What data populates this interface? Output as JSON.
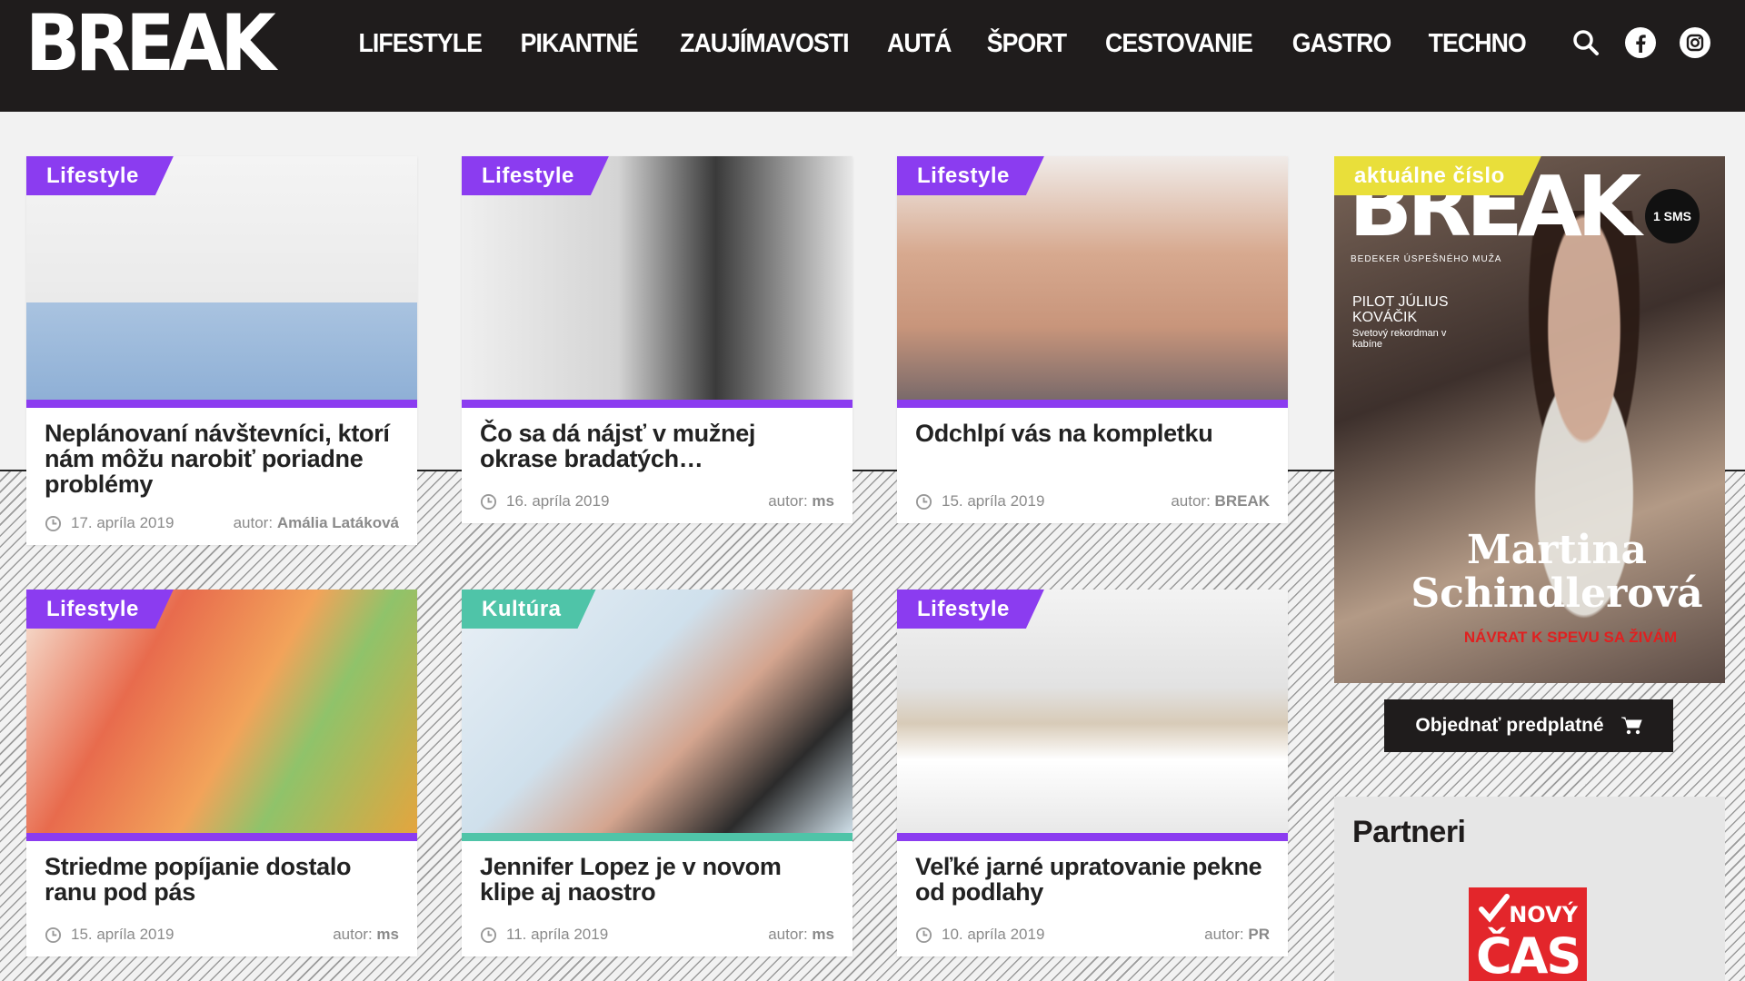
{
  "brand": {
    "logo_text": "BREAK"
  },
  "nav": {
    "items": [
      "LIFESTYLE",
      "PIKANTNÉ",
      "ZAUJÍMAVOSTI",
      "AUTÁ",
      "ŠPORT",
      "CESTOVANIE",
      "GASTRO",
      "TECHNO"
    ]
  },
  "header_icons": [
    "search-icon",
    "facebook-icon",
    "instagram-icon"
  ],
  "colors": {
    "header_bg": "#1f1c1c",
    "lifestyle": "#8b3cf0",
    "kultura": "#4fc4a8",
    "magazine_tag": "#e9df3a"
  },
  "articles": [
    {
      "tag": "Lifestyle",
      "title": "Neplánovaní návštevníci, ktorí nám môžu narobiť poriadne problémy",
      "date": "17. apríla 2019",
      "author_label": "autor:",
      "author": "Amália Latáková"
    },
    {
      "tag": "Lifestyle",
      "title": "Čo sa dá nájsť v mužnej okrase bradatých…",
      "date": "16. apríla 2019",
      "author_label": "autor:",
      "author": "ms"
    },
    {
      "tag": "Lifestyle",
      "title": "Odchlpí vás na kompletku",
      "date": "15. apríla 2019",
      "author_label": "autor:",
      "author": "BREAK"
    },
    {
      "tag": "Lifestyle",
      "title": "Striedme popíjanie dostalo ranu pod pás",
      "date": "15. apríla 2019",
      "author_label": "autor:",
      "author": "ms"
    },
    {
      "tag": "Kultúra",
      "title": "Jennifer Lopez je v novom klipe aj naostro",
      "date": "11. apríla 2019",
      "author_label": "autor:",
      "author": "ms"
    },
    {
      "tag": "Lifestyle",
      "title": "Veľké jarné upratovanie pekne od podlahy",
      "date": "10. apríla 2019",
      "author_label": "autor:",
      "author": "PR"
    }
  ],
  "sidebar": {
    "issue_tag": "aktuálne číslo",
    "cover": {
      "logo": "BREAK",
      "subtitle": "BEDEKER ÚSPEŠNÉHO MUŽA",
      "badge": "1 SMS",
      "side_title": "PILOT JÚLIUS KOVÁČIK",
      "side_sub": "Svetový rekordman v kabíne",
      "name": "Martina Schindlerová",
      "red_line": "NÁVRAT K SPEVU SA ŽIVÁM"
    },
    "subscribe_label": "Objednať predplatné",
    "partners_title": "Partneri",
    "partner_logo": {
      "top": "NOVÝ",
      "bottom": "ČAS"
    }
  }
}
